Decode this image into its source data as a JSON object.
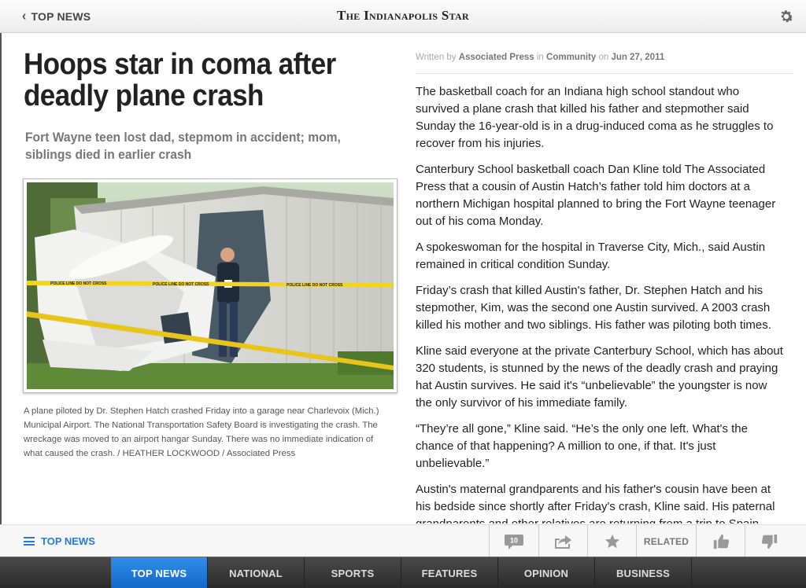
{
  "header": {
    "back_label": "TOP NEWS",
    "brand": "The Indianapolis Star"
  },
  "article": {
    "headline": "Hoops star in coma after deadly plane crash",
    "subhead": "Fort Wayne teen lost dad, stepmom in accident; mom, siblings died in earlier crash",
    "photo_caption": "A plane piloted by Dr. Stephen Hatch crashed Friday into a garage near Charlevoix (Mich.) Municipal Airport. The National Transportation Safety Board is investigating the crash. The wreckage was moved to an airport hangar Sunday. There was no immediate indication of what caused the crash. / HEATHER LOCKWOOD / Associated Press",
    "byline": {
      "written_by": "Written by",
      "author": "Associated Press",
      "in": "in",
      "section": "Community",
      "on": "on",
      "date": "Jun 27, 2011"
    },
    "paragraphs": [
      "The basketball coach for an Indiana high school standout who survived a plane crash that killed his father and stepmother said Sunday the 16-year-old is in a drug-induced coma as he struggles to recover from his injuries.",
      "Canterbury School basketball coach Dan Kline told The Associated Press that a cousin of Austin Hatch’s father told him doctors at a northern Michigan hospital planned to bring the Fort Wayne teenager out of his coma Monday.",
      "A spokeswoman for the hospital in Traverse City, Mich., said Austin remained in critical condition Sunday.",
      "Friday’s crash that killed Austin's father, Dr. Stephen Hatch and his stepmother, Kim, was the second one Austin survived. A 2003 crash killed his mother and two siblings. His father was piloting both times.",
      "Kline said everyone at the private Canterbury School, which has about 320 students, is stunned by the news of the deadly crash and praying hat Austin survives. He said it's “unbelievable” the youngster is now the only survivor of his immediate family.",
      "“They’re all gone,” Kline said. “He’s the only one left. What's the chance of that happening? A million to one, if that. It's just unbelievable.”",
      "Austin's maternal grandparents and his father's cousin have been at his bedside since shortly after Friday's crash, Kline said. His paternal grandparents and other relatives are returning from a trip to Spain."
    ]
  },
  "action_bar": {
    "section_label": "TOP NEWS",
    "comment_count": "10",
    "related_label": "RELATED",
    "icons": [
      "comment-icon",
      "share-icon",
      "star-icon",
      "thumbs-up-icon",
      "thumbs-down-icon"
    ]
  },
  "tabs": [
    {
      "label": "TOP NEWS",
      "active": true
    },
    {
      "label": "NATIONAL",
      "active": false
    },
    {
      "label": "SPORTS",
      "active": false
    },
    {
      "label": "FEATURES",
      "active": false
    },
    {
      "label": "OPINION",
      "active": false
    },
    {
      "label": "BUSINESS",
      "active": false
    }
  ],
  "colors": {
    "accent": "#2a7bd1",
    "active_tab": "#1f7ad8",
    "tab_bar": "#333333"
  }
}
